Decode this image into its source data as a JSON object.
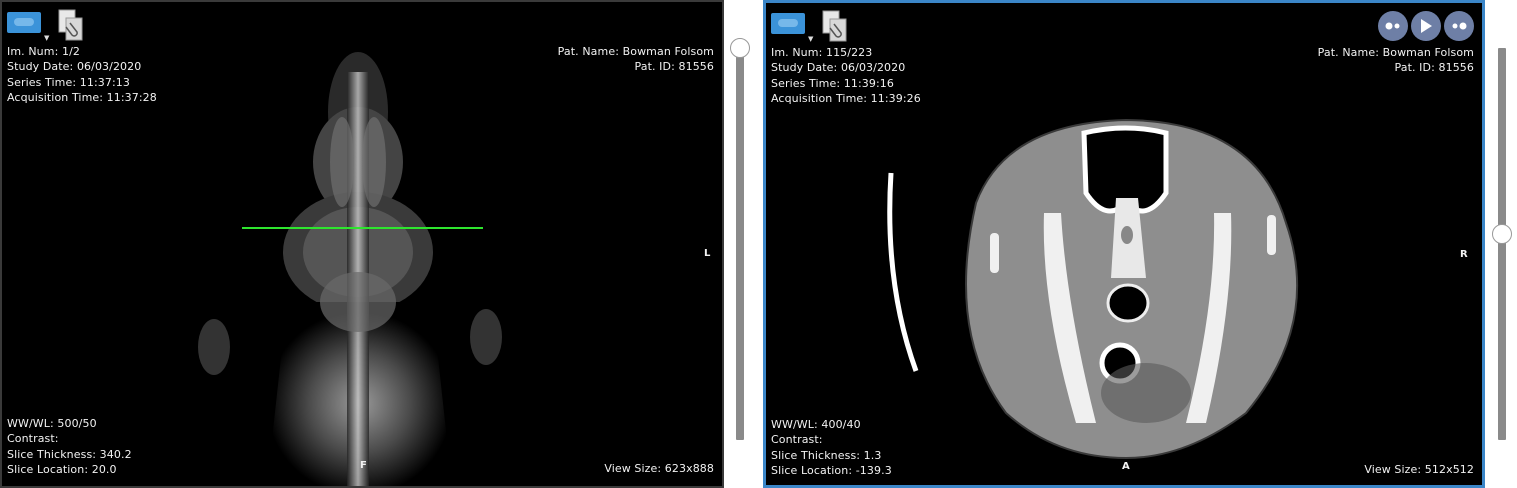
{
  "left_viewport": {
    "im_num": "Im. Num: 1/2",
    "study_date": "Study Date: 06/03/2020",
    "series_time": "Series Time: 11:37:13",
    "acquisition_time": "Acquisition Time: 11:37:28",
    "pat_name": "Pat. Name: Bowman Folsom",
    "pat_id": "Pat. ID: 81556",
    "ww_wl": "WW/WL: 500/50",
    "contrast": "Contrast:",
    "slice_thickness": "Slice Thickness: 340.2",
    "slice_location": "Slice Location: 20.0",
    "view_size": "View Size: 623x888",
    "orient_right": "L",
    "orient_bottom": "F",
    "slider_level": 0.0
  },
  "right_viewport": {
    "im_num": "Im. Num: 115/223",
    "study_date": "Study Date: 06/03/2020",
    "series_time": "Series Time: 11:39:16",
    "acquisition_time": "Acquisition Time: 11:39:26",
    "pat_name": "Pat. Name: Bowman Folsom",
    "pat_id": "Pat. ID: 81556",
    "ww_wl": "WW/WL: 400/40",
    "contrast": "Contrast:",
    "slice_thickness": "Slice Thickness: 1.3",
    "slice_location": "Slice Location: -139.3",
    "view_size": "View Size: 512x512",
    "orient_right": "R",
    "orient_bottom": "A",
    "slider_level": 0.5
  },
  "icons": {
    "monitor": "monitor-layout-icon",
    "clip": "paperclip-icon",
    "prev": "previous-frame-icon",
    "play": "play-icon",
    "next": "next-frame-icon"
  },
  "colors": {
    "active_border": "#3b86c8",
    "reference_line": "#2ee52e",
    "play_buttons": "#6e7fa6"
  }
}
